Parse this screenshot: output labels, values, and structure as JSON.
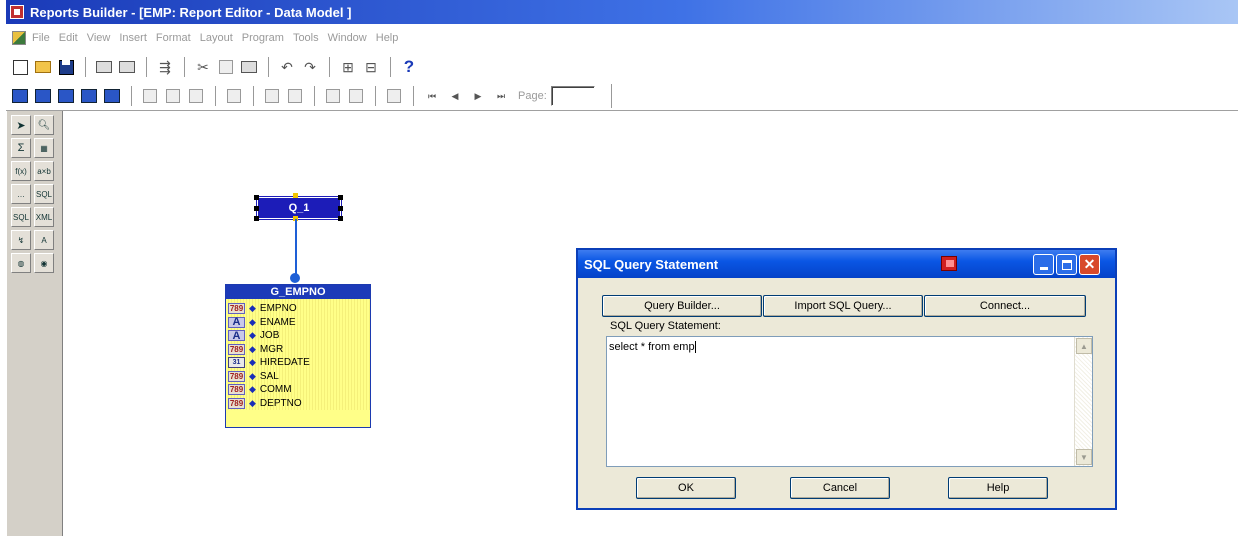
{
  "window": {
    "title": "Reports Builder - [EMP: Report Editor - Data Model ]"
  },
  "menu": [
    "File",
    "Edit",
    "View",
    "Insert",
    "Format",
    "Layout",
    "Program",
    "Tools",
    "Window",
    "Help"
  ],
  "toolbar2": {
    "page_label": "Page:",
    "page_value": ""
  },
  "query": {
    "name": "Q_1"
  },
  "group": {
    "name": "G_EMPNO",
    "columns": [
      {
        "name": "EMPNO",
        "type": "number"
      },
      {
        "name": "ENAME",
        "type": "character"
      },
      {
        "name": "JOB",
        "type": "character"
      },
      {
        "name": "MGR",
        "type": "number"
      },
      {
        "name": "HIREDATE",
        "type": "date"
      },
      {
        "name": "SAL",
        "type": "number"
      },
      {
        "name": "COMM",
        "type": "number"
      },
      {
        "name": "DEPTNO",
        "type": "number"
      }
    ],
    "number_icon_text": "789",
    "char_icon_text": "A",
    "date_icon_text": "31"
  },
  "dialog": {
    "title": "SQL Query Statement",
    "query_builder_label": "Query Builder...",
    "import_sql_label": "Import SQL Query...",
    "connect_label": "Connect...",
    "sql_label": "SQL Query Statement:",
    "sql_text": "select * from emp",
    "ok_label": "OK",
    "cancel_label": "Cancel",
    "help_label": "Help"
  },
  "colors": {
    "titlebar": "#1a3ab8",
    "query_fill": "#1c1cb8",
    "group_fill": "#ffff88",
    "link": "#1e5fd6",
    "dialog_title": "#0a56e4"
  }
}
